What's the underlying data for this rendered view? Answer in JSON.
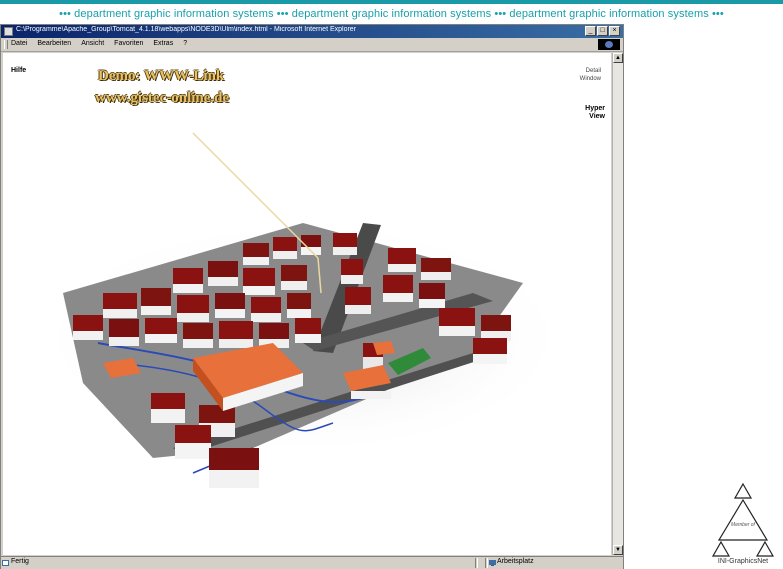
{
  "banner": {
    "text": "••• department graphic information systems ••• department graphic information systems ••• department graphic information systems •••"
  },
  "window": {
    "title": "C:\\Programme\\Apache_Group\\Tomcat_4.1.18\\webapps\\NODE3D\\Ulm\\index.html - Microsoft Internet Explorer",
    "buttons": {
      "minimize": "_",
      "maximize": "□",
      "close": "×"
    }
  },
  "menubar": {
    "items": [
      "Datei",
      "Bearbeiten",
      "Ansicht",
      "Favoriten",
      "Extras",
      "?"
    ]
  },
  "page": {
    "hilfe": "Hilfe",
    "detail_line1": "Detail",
    "detail_line2": "Window",
    "hyper_line1": "Hyper",
    "hyper_line2": "View",
    "demo_line1": "Demo: WWW-Link",
    "demo_line2": "www.gistec-online.de"
  },
  "statusbar": {
    "left": "Fertig",
    "zone": "Arbeitsplatz"
  },
  "logo": {
    "member": "Member of",
    "name": "INI-GraphicsNet"
  },
  "colors": {
    "banner_teal": "#16a0ab",
    "roof_red": "#8a1210",
    "highlight_orange": "#e8703a",
    "street_gray": "#5a5a5a",
    "green_area": "#2f8a3a",
    "blue_lines": "#2a4ab8",
    "demo_gold": "#e8c068"
  }
}
